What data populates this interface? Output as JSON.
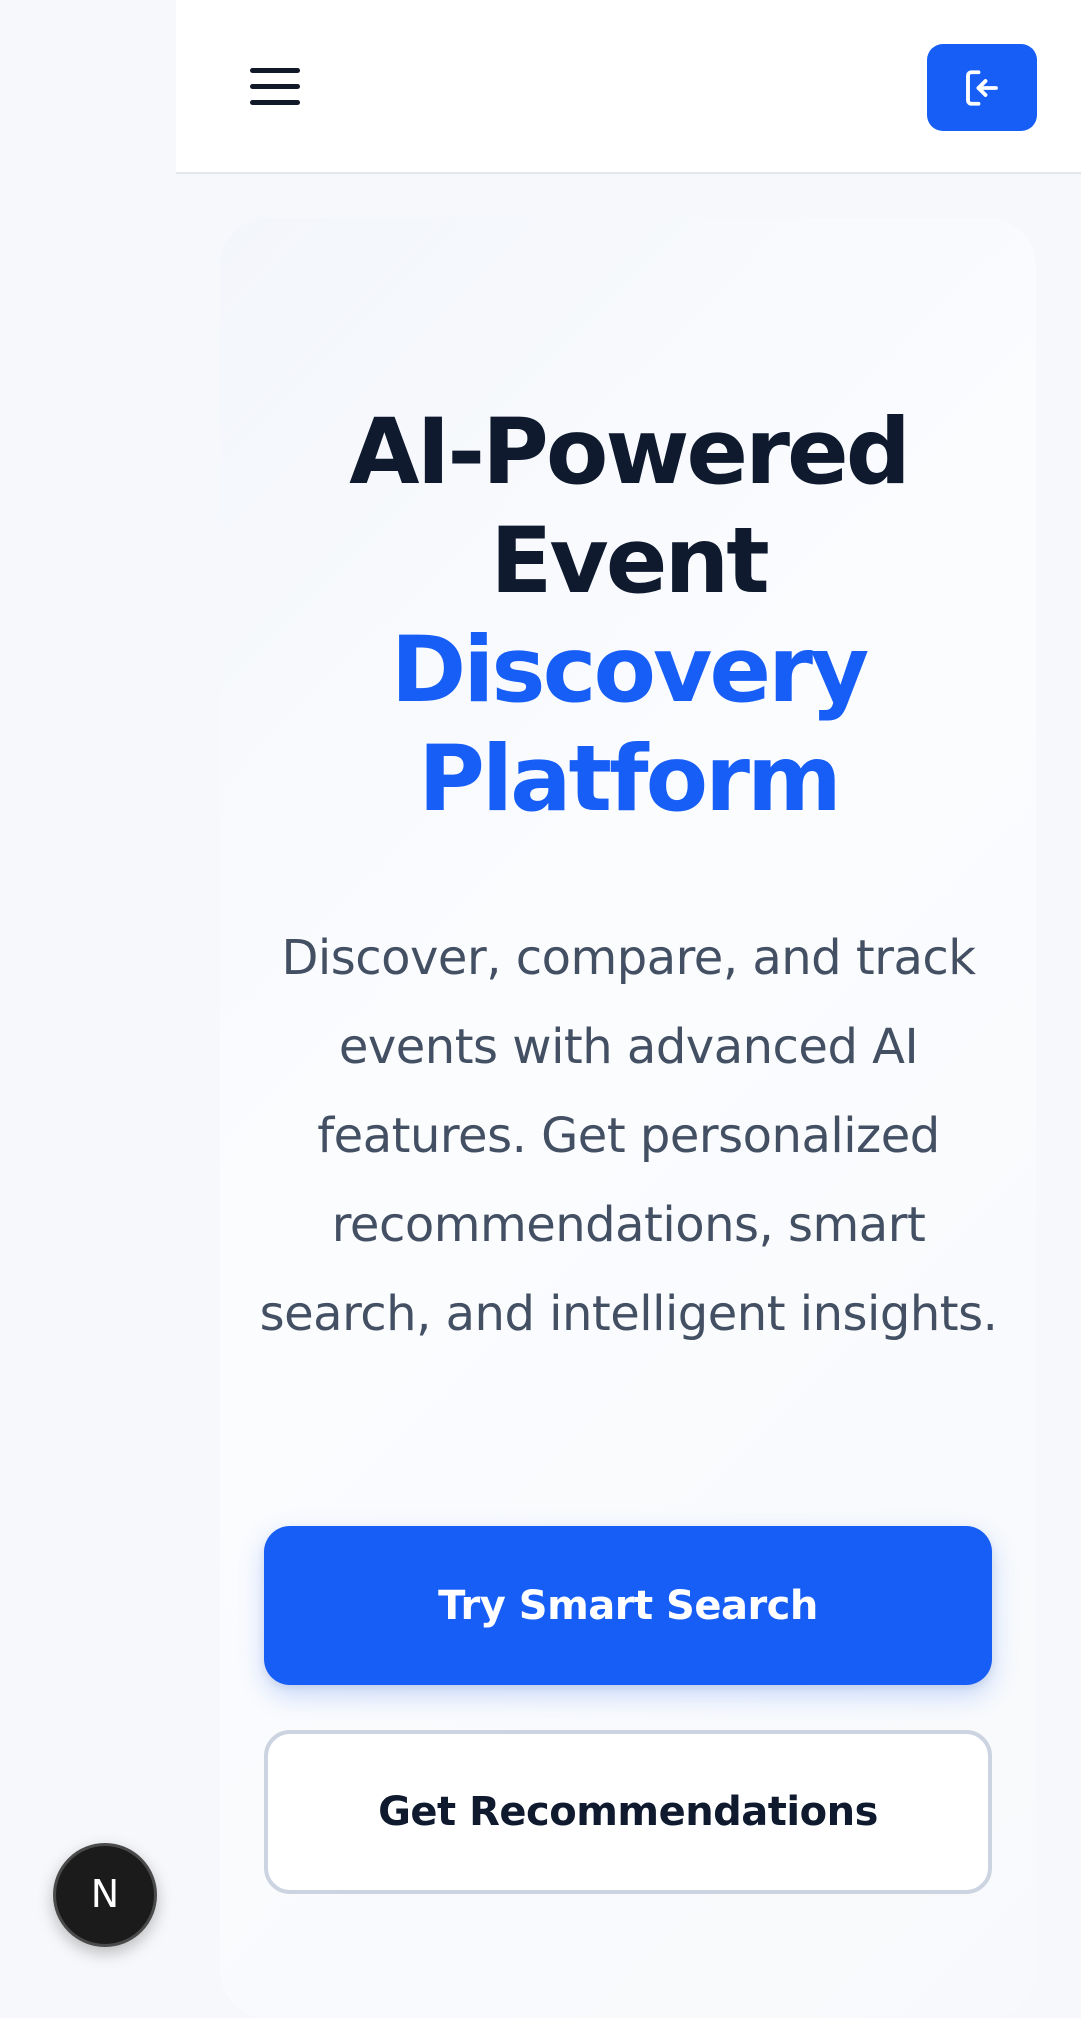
{
  "header": {
    "menu_icon": "hamburger-menu-icon",
    "login_icon": "login-icon",
    "accent_color": "#175ef6"
  },
  "hero": {
    "title_line1": "AI-Powered",
    "title_line2": "Event",
    "title_accent_line1": "Discovery",
    "title_accent_line2": "Platform",
    "description": "Discover, compare, and track events with advanced AI features. Get personalized recommendations, smart search, and intelligent insights.",
    "primary_button_label": "Try Smart Search",
    "secondary_button_label": "Get Recommendations"
  },
  "dev_badge": {
    "label": "N"
  }
}
